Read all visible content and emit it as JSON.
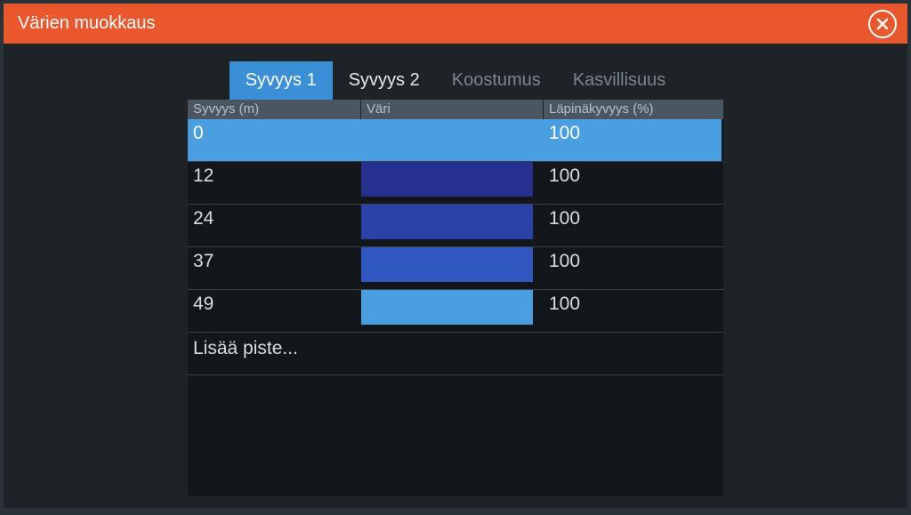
{
  "header": {
    "title": "Värien muokkaus"
  },
  "tabs": [
    {
      "label": "Syvyys 1",
      "state": "active"
    },
    {
      "label": "Syvyys 2",
      "state": "secondary"
    },
    {
      "label": "Koostumus",
      "state": ""
    },
    {
      "label": "Kasvillisuus",
      "state": ""
    }
  ],
  "columns": {
    "depth": "Syvyys (m)",
    "color": "Väri",
    "transparency": "Läpinäkyvyys (%)"
  },
  "rows": [
    {
      "depth": "0",
      "color": "#4a9fe0",
      "transparency": "100",
      "highlight": true
    },
    {
      "depth": "12",
      "color": "#26308f",
      "transparency": "100",
      "highlight": false
    },
    {
      "depth": "24",
      "color": "#2a42a8",
      "transparency": "100",
      "highlight": false
    },
    {
      "depth": "37",
      "color": "#2f57bf",
      "transparency": "100",
      "highlight": false
    },
    {
      "depth": "49",
      "color": "#4a9fe0",
      "transparency": "100",
      "highlight": false
    }
  ],
  "addRow": "Lisää piste..."
}
